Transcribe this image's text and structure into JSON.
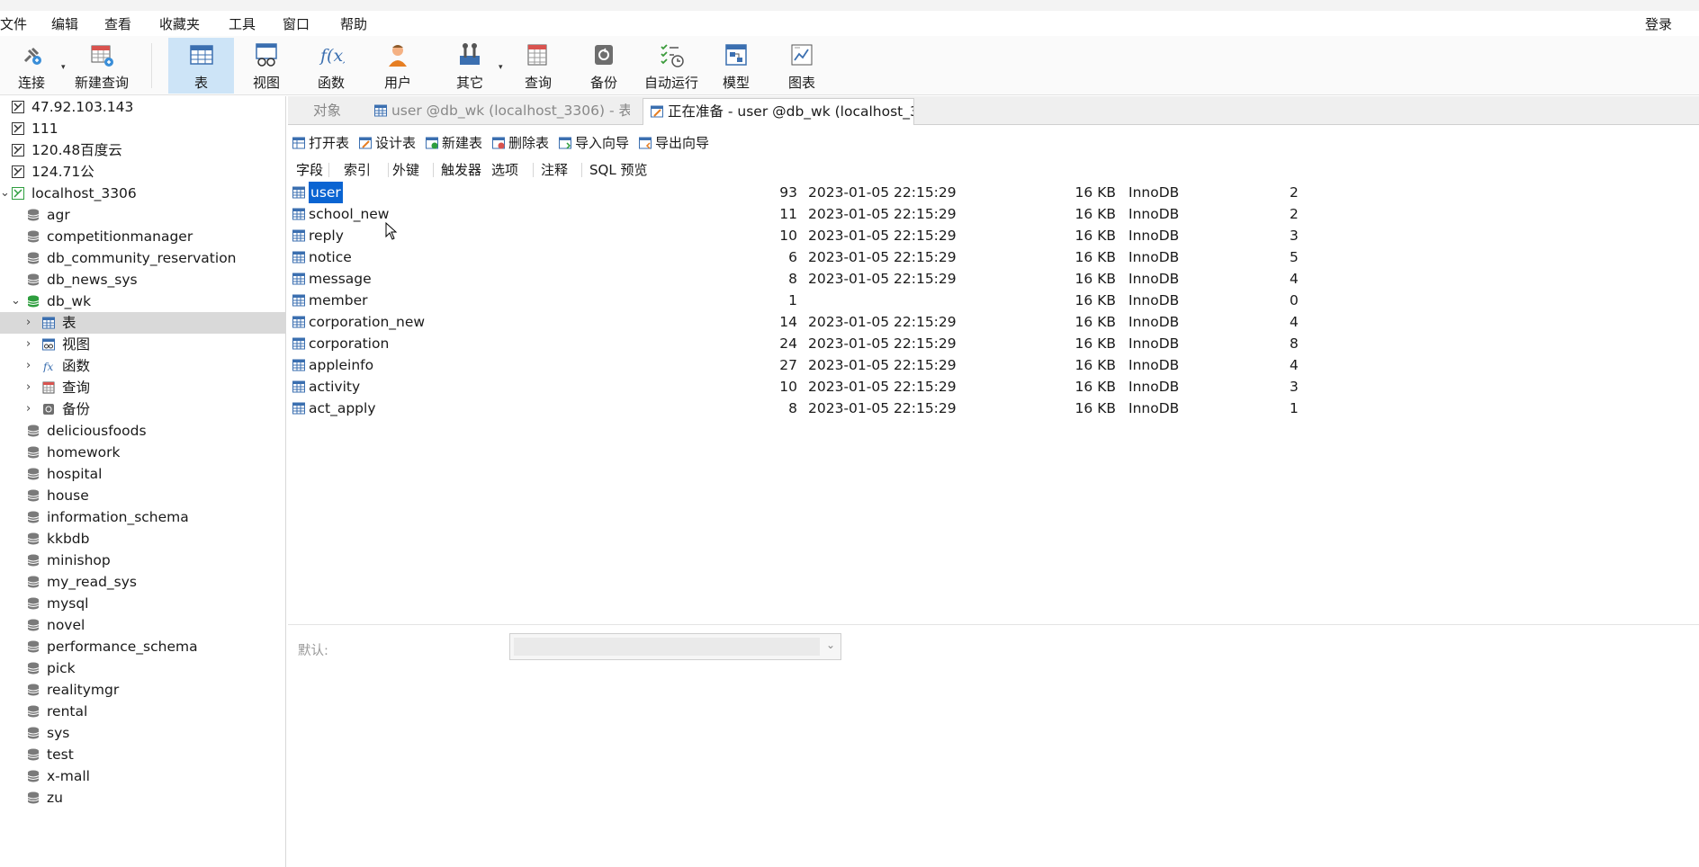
{
  "menu": [
    "文件",
    "编辑",
    "查看",
    "收藏夹",
    "工具",
    "窗口",
    "帮助"
  ],
  "login": "登录",
  "toolbar": [
    {
      "label": "连接",
      "icon": "plug-icon"
    },
    {
      "label": "新建查询",
      "icon": "new-query-icon"
    },
    {
      "label": "表",
      "icon": "table-icon"
    },
    {
      "label": "视图",
      "icon": "view-icon"
    },
    {
      "label": "函数",
      "icon": "function-icon"
    },
    {
      "label": "用户",
      "icon": "user-icon"
    },
    {
      "label": "其它",
      "icon": "tools-icon"
    },
    {
      "label": "查询",
      "icon": "query-icon"
    },
    {
      "label": "备份",
      "icon": "backup-icon"
    },
    {
      "label": "自动运行",
      "icon": "schedule-icon"
    },
    {
      "label": "模型",
      "icon": "model-icon"
    },
    {
      "label": "图表",
      "icon": "chart-icon"
    }
  ],
  "sidebar": {
    "connections": [
      "47.92.103.143",
      "111",
      "120.48百度云",
      "124.71公"
    ],
    "localhost": "localhost_3306",
    "databases_before": [
      "agr",
      "competitionmanager",
      "db_community_reservation",
      "db_news_sys"
    ],
    "open_db": "db_wk",
    "db_children": [
      "表",
      "视图",
      "函数",
      "查询",
      "备份"
    ],
    "databases_after": [
      "deliciousfoods",
      "homework",
      "hospital",
      "house",
      "information_schema",
      "kkbdb",
      "minishop",
      "my_read_sys",
      "mysql",
      "novel",
      "performance_schema",
      "pick",
      "realitymgr",
      "rental",
      "sys",
      "test",
      "x-mall",
      "zu"
    ]
  },
  "tabs": [
    "对象",
    "user @db_wk (localhost_3306) - 表",
    "正在准备 - user @db_wk (localhost_3..."
  ],
  "actions": [
    "打开表",
    "设计表",
    "新建表",
    "删除表",
    "导入向导",
    "导出向导"
  ],
  "subtabs": [
    "字段",
    "索引",
    "外键",
    "触发器",
    "选项",
    "注释",
    "SQL 预览"
  ],
  "tables": [
    {
      "name": "user",
      "rows": "93",
      "time": "2023-01-05 22:15:29",
      "size": "16 KB",
      "engine": "InnoDB",
      "n": "2"
    },
    {
      "name": "school_new",
      "rows": "11",
      "time": "2023-01-05 22:15:29",
      "size": "16 KB",
      "engine": "InnoDB",
      "n": "2"
    },
    {
      "name": "reply",
      "rows": "10",
      "time": "2023-01-05 22:15:29",
      "size": "16 KB",
      "engine": "InnoDB",
      "n": "3"
    },
    {
      "name": "notice",
      "rows": "6",
      "time": "2023-01-05 22:15:29",
      "size": "16 KB",
      "engine": "InnoDB",
      "n": "5"
    },
    {
      "name": "message",
      "rows": "8",
      "time": "2023-01-05 22:15:29",
      "size": "16 KB",
      "engine": "InnoDB",
      "n": "4"
    },
    {
      "name": "member",
      "rows": "1",
      "time": "",
      "size": "16 KB",
      "engine": "InnoDB",
      "n": "0"
    },
    {
      "name": "corporation_new",
      "rows": "14",
      "time": "2023-01-05 22:15:29",
      "size": "16 KB",
      "engine": "InnoDB",
      "n": "4"
    },
    {
      "name": "corporation",
      "rows": "24",
      "time": "2023-01-05 22:15:29",
      "size": "16 KB",
      "engine": "InnoDB",
      "n": "8"
    },
    {
      "name": "appleinfo",
      "rows": "27",
      "time": "2023-01-05 22:15:29",
      "size": "16 KB",
      "engine": "InnoDB",
      "n": "4"
    },
    {
      "name": "activity",
      "rows": "10",
      "time": "2023-01-05 22:15:29",
      "size": "16 KB",
      "engine": "InnoDB",
      "n": "3"
    },
    {
      "name": "act_apply",
      "rows": "8",
      "time": "2023-01-05 22:15:29",
      "size": "16 KB",
      "engine": "InnoDB",
      "n": "1"
    }
  ],
  "default_label": "默认:",
  "colors": {
    "accent": "#0a64d2",
    "active_tool": "#cde4f7",
    "selected_row": "#d9d9d9"
  }
}
